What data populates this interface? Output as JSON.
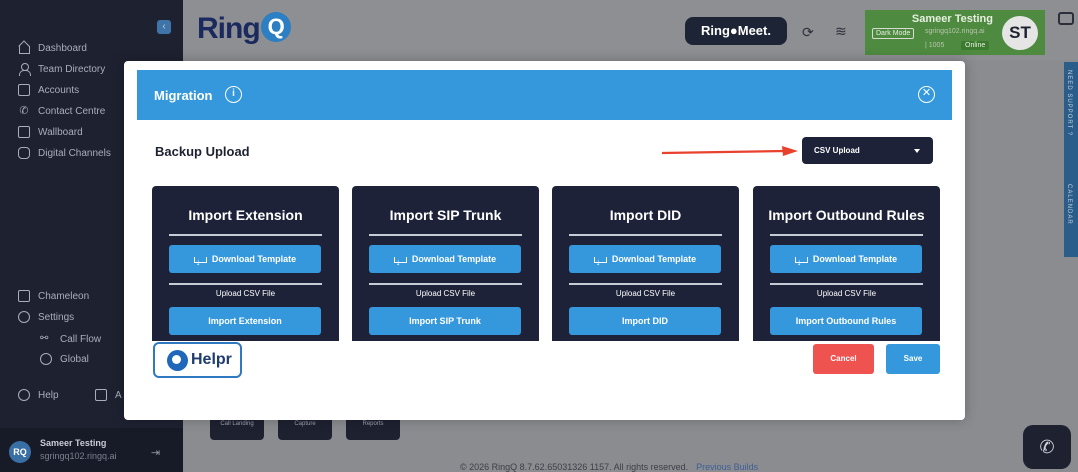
{
  "sidebar": {
    "collapse_icon": "chevron-left-icon",
    "nav_top": [
      {
        "label": "Dashboard",
        "icon": "home-icon"
      },
      {
        "label": "Team Directory",
        "icon": "person-icon"
      },
      {
        "label": "Accounts",
        "icon": "contact-card-icon"
      },
      {
        "label": "Contact Centre",
        "icon": "phone-icon"
      },
      {
        "label": "Wallboard",
        "icon": "board-icon"
      },
      {
        "label": "Digital Channels",
        "icon": "chat-icon"
      }
    ],
    "nav_bottom": [
      {
        "label": "Chameleon",
        "icon": "tablet-icon"
      },
      {
        "label": "Settings",
        "icon": "gear-icon"
      },
      {
        "label": "Call Flow",
        "icon": "flow-icon"
      },
      {
        "label": "Global",
        "icon": "globe-icon"
      },
      {
        "label": "Help",
        "icon": "help-icon"
      },
      {
        "label": "A",
        "icon": "app-icon"
      }
    ],
    "user": {
      "initials": "RQ",
      "name": "Sameer Testing",
      "email": "sgringq102.ringq.ai"
    }
  },
  "header": {
    "logo_text": "Ring",
    "logo_q": "Q",
    "meet_label": "Ring●Meet.",
    "user_card": {
      "name": "Sameer Testing",
      "dark_mode_label": "Dark Mode",
      "email": "sgringq102.ringq.ai",
      "extension": "| 1005",
      "status": "Online",
      "initials": "ST",
      "color": "#4e8a40"
    }
  },
  "right_tabs": [
    "NEED SUPPORT ?",
    "CALENDAR"
  ],
  "background_tiles": [
    "Call Landing",
    "Capture",
    "Reports"
  ],
  "footer": {
    "copyright": "© 2026 RingQ 8.7.62.65031326 1157. All rights reserved.",
    "link": "Previous Builds"
  },
  "modal": {
    "title": "Migration",
    "header_color": "#3598dc",
    "section_label": "Backup Upload",
    "upload_type": "CSV Upload",
    "cards": [
      {
        "title": "Import Extension",
        "download_label": "Download Template",
        "upload_label": "Upload CSV File",
        "import_label": "Import Extension"
      },
      {
        "title": "Import SIP Trunk",
        "download_label": "Download Template",
        "upload_label": "Upload CSV File",
        "import_label": "Import SIP Trunk"
      },
      {
        "title": "Import DID",
        "download_label": "Download Template",
        "upload_label": "Upload CSV File",
        "import_label": "Import DID"
      },
      {
        "title": "Import Outbound Rules",
        "download_label": "Download Template",
        "upload_label": "Upload CSV File",
        "import_label": "Import Outbound Rules"
      }
    ],
    "helpr_label": "Helpr",
    "cancel_label": "Cancel",
    "save_label": "Save",
    "cancel_color": "#ef5350"
  }
}
